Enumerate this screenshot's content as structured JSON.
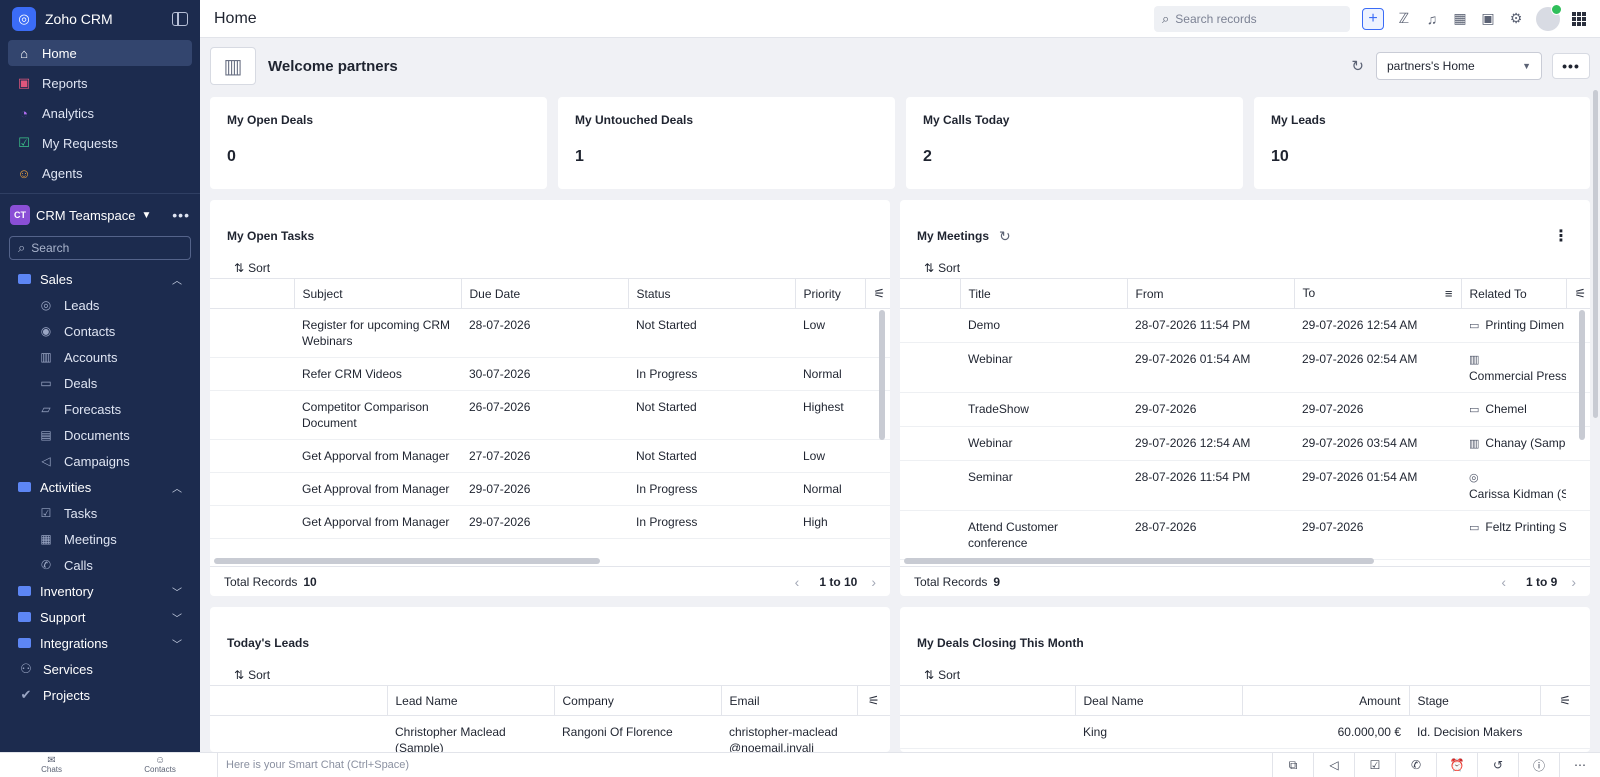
{
  "brand": {
    "name": "Zoho CRM"
  },
  "topbar": {
    "title": "Home",
    "search_placeholder": "Search records"
  },
  "nav": [
    {
      "label": "Home",
      "icon": "home-icon"
    },
    {
      "label": "Reports",
      "icon": "reports-icon"
    },
    {
      "label": "Analytics",
      "icon": "analytics-icon"
    },
    {
      "label": "My Requests",
      "icon": "requests-icon"
    },
    {
      "label": "Agents",
      "icon": "agents-icon"
    }
  ],
  "teamspace": {
    "badge": "CT",
    "name": "CRM Teamspace",
    "search_placeholder": "Search"
  },
  "groups": {
    "sales": {
      "label": "Sales",
      "items": [
        "Leads",
        "Contacts",
        "Accounts",
        "Deals",
        "Forecasts",
        "Documents",
        "Campaigns"
      ]
    },
    "activities": {
      "label": "Activities",
      "items": [
        "Tasks",
        "Meetings",
        "Calls"
      ]
    },
    "inventory": "Inventory",
    "support": "Support",
    "integrations": "Integrations",
    "services": "Services",
    "projects": "Projects"
  },
  "welcome": {
    "text": "Welcome partners",
    "view": "partners's Home"
  },
  "kpis": [
    {
      "label": "My Open Deals",
      "value": "0"
    },
    {
      "label": "My Untouched Deals",
      "value": "1"
    },
    {
      "label": "My Calls Today",
      "value": "2"
    },
    {
      "label": "My Leads",
      "value": "10"
    }
  ],
  "sort_label": "Sort",
  "total_label": "Total Records",
  "tasks": {
    "title": "My Open Tasks",
    "columns": [
      "Subject",
      "Due Date",
      "Status",
      "Priority"
    ],
    "rows": [
      [
        "Register for upcoming CRM Webinars",
        "28-07-2026",
        "Not Started",
        "Low"
      ],
      [
        "Refer CRM Videos",
        "30-07-2026",
        "In Progress",
        "Normal"
      ],
      [
        "Competitor Comparison Document",
        "26-07-2026",
        "Not Started",
        "Highest"
      ],
      [
        "Get Apporval from Manager",
        "27-07-2026",
        "Not Started",
        "Low"
      ],
      [
        "Get Approval from Manager",
        "29-07-2026",
        "In Progress",
        "Normal"
      ],
      [
        "Get Apporval from Manager",
        "29-07-2026",
        "In Progress",
        "High"
      ]
    ],
    "total": "10",
    "range": "1 to 10"
  },
  "meetings": {
    "title": "My Meetings",
    "columns": [
      "Title",
      "From",
      "To",
      "Related To"
    ],
    "rows": [
      [
        "Demo",
        "28-07-2026 11:54 PM",
        "29-07-2026 12:54 AM",
        "Printing Dimen"
      ],
      [
        "Webinar",
        "29-07-2026 01:54 AM",
        "29-07-2026 02:54 AM",
        "Commercial Press"
      ],
      [
        "TradeShow",
        "29-07-2026",
        "29-07-2026",
        "Chemel"
      ],
      [
        "Webinar",
        "29-07-2026 12:54 AM",
        "29-07-2026 03:54 AM",
        "Chanay (Samp"
      ],
      [
        "Seminar",
        "28-07-2026 11:54 PM",
        "29-07-2026 01:54 AM",
        "Carissa Kidman (S"
      ],
      [
        "Attend Customer conference",
        "28-07-2026",
        "29-07-2026",
        "Feltz Printing S"
      ]
    ],
    "total": "9",
    "range": "1 to 9"
  },
  "leads": {
    "title": "Today's Leads",
    "columns": [
      "Lead Name",
      "Company",
      "Email"
    ],
    "rows": [
      [
        "Christopher Maclead (Sample)",
        "Rangoni Of Florence",
        "christopher-maclead@noemail.invali"
      ]
    ]
  },
  "deals": {
    "title": "My Deals Closing This Month",
    "columns": [
      "Deal Name",
      "Amount",
      "Stage"
    ],
    "rows": [
      [
        "King",
        "60.000,00 €",
        "Id. Decision Makers"
      ]
    ]
  },
  "bottombar": {
    "chats": "Chats",
    "contacts": "Contacts",
    "smart_chat": "Here is your Smart Chat (Ctrl+Space)"
  }
}
